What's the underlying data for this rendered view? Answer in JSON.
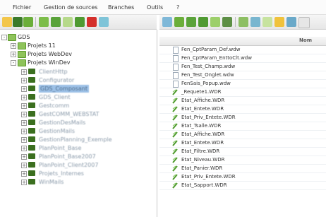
{
  "menu": [
    "Fichier",
    "Gestion de sources",
    "Branches",
    "Outils",
    "?"
  ],
  "left_tree": [
    {
      "label": "GDS",
      "level": 0,
      "icon": "folder-icon",
      "expanded": true
    },
    {
      "label": "Projets 11",
      "level": 1,
      "icon": "folder-icon",
      "expanded": false
    },
    {
      "label": "Projets WebDev",
      "level": 1,
      "icon": "folder-icon",
      "expanded": false
    },
    {
      "label": "Projets WinDev",
      "level": 1,
      "icon": "folder-icon",
      "expanded": true
    },
    {
      "label": "ClientHttp",
      "level": 2,
      "icon": "project-icon",
      "blurred": true
    },
    {
      "label": "Configurator",
      "level": 2,
      "icon": "project-icon",
      "blurred": true
    },
    {
      "label": "GDS_Composant",
      "level": 2,
      "icon": "project-icon",
      "blurred": true,
      "selected": true
    },
    {
      "label": "GDS_Client",
      "level": 2,
      "icon": "project-icon",
      "blurred": true
    },
    {
      "label": "Gestcomm",
      "level": 2,
      "icon": "project-icon",
      "blurred": true
    },
    {
      "label": "GestCOMM_WEBSTAT",
      "level": 2,
      "icon": "project-icon",
      "blurred": true
    },
    {
      "label": "GestionDesMails",
      "level": 2,
      "icon": "project-icon",
      "blurred": true
    },
    {
      "label": "GestionMails",
      "level": 2,
      "icon": "project-icon",
      "blurred": true
    },
    {
      "label": "GestionPlanning_Exemple",
      "level": 2,
      "icon": "project-icon",
      "blurred": true
    },
    {
      "label": "PlanPoint_Base",
      "level": 2,
      "icon": "project-icon",
      "blurred": true
    },
    {
      "label": "PlanPoint_Base2007",
      "level": 2,
      "icon": "project-icon",
      "blurred": true
    },
    {
      "label": "PlanPoint_Client2007",
      "level": 2,
      "icon": "project-icon",
      "blurred": true
    },
    {
      "label": "Projets_Internes",
      "level": 2,
      "icon": "project-icon",
      "blurred": true
    },
    {
      "label": "WinMails",
      "level": 2,
      "icon": "project-icon",
      "blurred": true
    }
  ],
  "right_header": "Nom",
  "files": [
    {
      "label": "Fen_CptParam_Def.wdw",
      "icon": "window-file-icon"
    },
    {
      "label": "Fen_CptParam_EnttoClt.wdw",
      "icon": "window-file-icon"
    },
    {
      "label": "Fen_Test_Champ.wdw",
      "icon": "window-file-icon"
    },
    {
      "label": "Fen_Test_Onglet.wdw",
      "icon": "window-file-icon"
    },
    {
      "label": "FenSais_Popup.wdw",
      "icon": "window-file-icon"
    },
    {
      "label": "_Requete1.WDR",
      "icon": "report-icon"
    },
    {
      "label": "Etat_Affiche.WDR",
      "icon": "report-icon"
    },
    {
      "label": "Etat_Entete.WDR",
      "icon": "report-icon"
    },
    {
      "label": "Etat_Priv_Entete.WDR",
      "icon": "report-icon"
    },
    {
      "label": "Etat_Tsalle.WDR",
      "icon": "report-icon"
    },
    {
      "label": "Etat_Affiche.WDR",
      "icon": "report-icon"
    },
    {
      "label": "Etat_Entete.WDR",
      "icon": "report-icon"
    },
    {
      "label": "Etat_Filtre.WDR",
      "icon": "report-icon"
    },
    {
      "label": "Etat_Niveau.WDR",
      "icon": "report-icon"
    },
    {
      "label": "Etat_Panier.WDR",
      "icon": "report-icon"
    },
    {
      "label": "Etat_Priv_Entete.WDR",
      "icon": "report-icon"
    },
    {
      "label": "Etat_Sapport.WDR",
      "icon": "report-icon"
    }
  ],
  "colors": {
    "accent": "#5d9a2c",
    "selected": "#9cc0e6"
  }
}
